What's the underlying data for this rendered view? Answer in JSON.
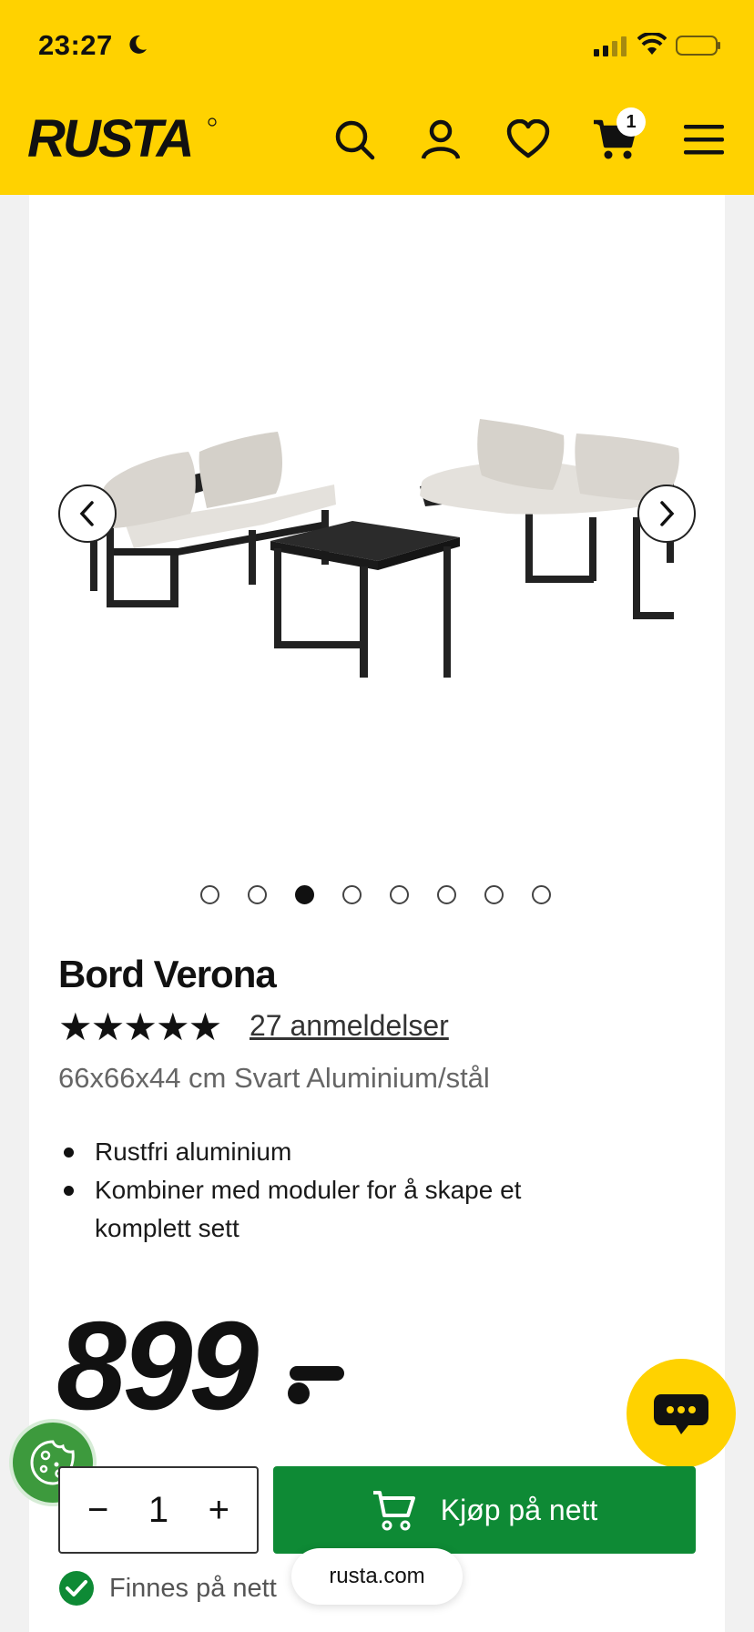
{
  "status_bar": {
    "time": "23:27"
  },
  "header": {
    "brand": "RUSTA",
    "cart_count": "1"
  },
  "gallery": {
    "active_index": 2,
    "dot_count": 8
  },
  "product": {
    "title": "Bord Verona",
    "stars": "★★★★★",
    "rating": 5,
    "reviews_label": "27 anmeldelser",
    "subtitle": "66x66x44 cm Svart Aluminium/stål",
    "bullets": [
      "Rustfri aluminium",
      "Kombiner med moduler for å skape et komplett sett"
    ],
    "price": "899"
  },
  "purchase": {
    "minus": "−",
    "plus": "+",
    "quantity": "1",
    "buy_label": "Kjøp på nett",
    "stock_text": "Finnes på nett"
  },
  "browser": {
    "url": "rusta.com"
  },
  "colors": {
    "brand_yellow": "#ffd200",
    "buy_green": "#0e8a35",
    "cookie_green": "#3d9a3d"
  }
}
